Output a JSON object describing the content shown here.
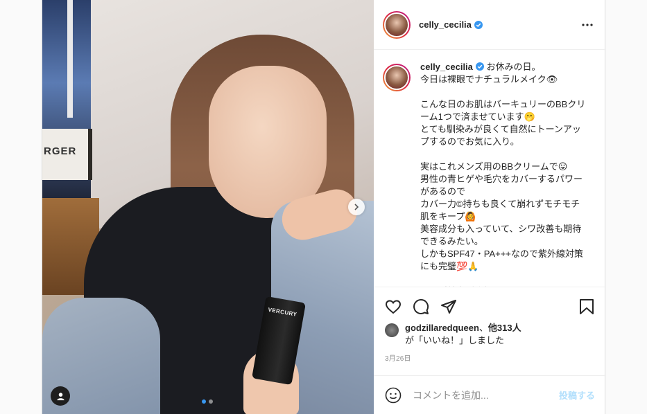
{
  "post": {
    "username": "celly_cecilia",
    "verified": true,
    "caption": "お休みの日。\n今日は裸眼でナチュラルメイク👁\n\nこんな日のお肌はバーキュリーのBBクリーム1つで済ませています🫢\nとても馴染みが良くて自然にトーンアップするのでお気に入り。\n\n実はこれメンズ用のBBクリームで😛\n男性の青ヒゲや毛穴をカバーするパワーがあるので\nカバー力©持ちも良くて崩れずモチモチ肌をキープ🙆\n美容成分も入っていて、シワ改善も期待できるみたい。\nしかもSPF47・PA+++なので紫外線対策にも完璧💯🙏\n\nメンズ美容が流行ってるけど、こんな",
    "photo_text": {
      "sign": "RGER",
      "product": "VERCURY"
    },
    "carousel": {
      "total": 2,
      "current": 1
    }
  },
  "likes": {
    "first_user": "godzillaredqueen",
    "separator": "、",
    "others": "他313人",
    "suffix": "が「いいね！」しました"
  },
  "date": "3月26日",
  "comment_input": {
    "placeholder": "コメントを追加...",
    "post_label": "投稿する"
  },
  "colors": {
    "accent": "#3897f0",
    "post_disabled": "#b2dffc",
    "muted": "#8e8e8e"
  },
  "icons": [
    "more-icon",
    "heart-icon",
    "comment-icon",
    "share-icon",
    "bookmark-icon",
    "emoji-icon",
    "chevron-right-icon",
    "user-tag-icon",
    "verified-icon"
  ]
}
